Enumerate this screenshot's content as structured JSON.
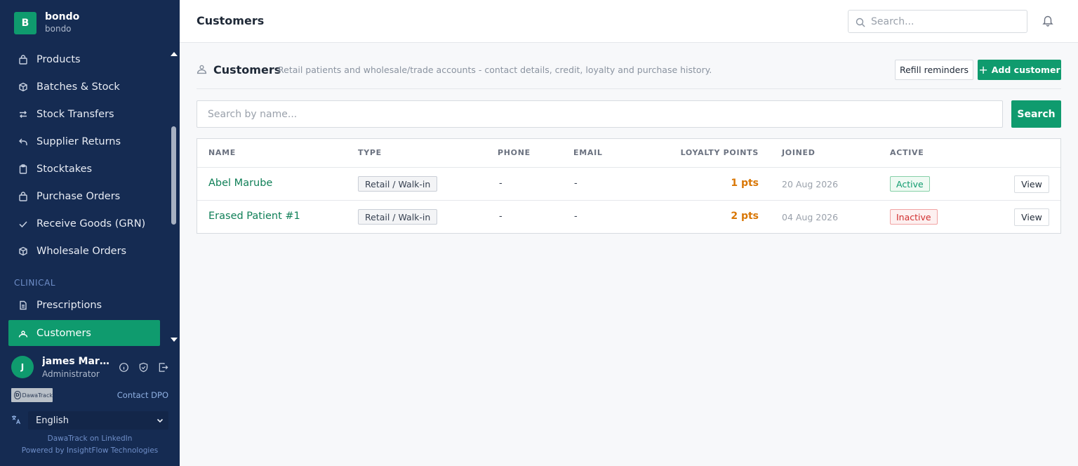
{
  "brand": {
    "initial": "B",
    "name": "bondo",
    "subtitle": "bondo"
  },
  "sidebar": {
    "items": [
      {
        "label": "Products",
        "icon": "bag-icon"
      },
      {
        "label": "Batches & Stock",
        "icon": "box-icon"
      },
      {
        "label": "Stock Transfers",
        "icon": "transfer-arrows-icon"
      },
      {
        "label": "Supplier Returns",
        "icon": "return-arrow-icon"
      },
      {
        "label": "Stocktakes",
        "icon": "clipboard-icon"
      },
      {
        "label": "Purchase Orders",
        "icon": "bag-icon"
      },
      {
        "label": "Receive Goods (GRN)",
        "icon": "check-icon"
      },
      {
        "label": "Wholesale Orders",
        "icon": "box-icon"
      }
    ],
    "section_clinical": "CLINICAL",
    "clinical_items": [
      {
        "label": "Prescriptions",
        "icon": "document-icon"
      },
      {
        "label": "Customers",
        "icon": "users-icon",
        "active": true
      }
    ]
  },
  "user": {
    "initial": "J",
    "name": "james Maru...",
    "role": "Administrator"
  },
  "dpo": {
    "logo_text": "DawaTrack",
    "contact_label": "Contact DPO"
  },
  "language": {
    "selected": "English"
  },
  "footer": {
    "linkedin": "DawaTrack on LinkedIn",
    "powered_by": "Powered by InsightFlow Technologies"
  },
  "topbar": {
    "title": "Customers",
    "search_placeholder": "Search..."
  },
  "content": {
    "title": "Customers",
    "description": "Retail patients and wholesale/trade accounts - contact details, credit, loyalty and purchase history.",
    "refill_label": "Refill reminders",
    "add_label": "Add customer",
    "search_placeholder": "Search by name...",
    "search_button": "Search"
  },
  "table": {
    "columns": [
      "NAME",
      "TYPE",
      "PHONE",
      "EMAIL",
      "LOYALTY POINTS",
      "JOINED",
      "ACTIVE"
    ],
    "rows": [
      {
        "name": "Abel Marube",
        "type": "Retail / Walk-in",
        "phone": "-",
        "email": "-",
        "points": "1 pts",
        "joined": "20 Aug 2026",
        "active": "Active",
        "action": "View"
      },
      {
        "name": "Erased Patient #1",
        "type": "Retail / Walk-in",
        "phone": "-",
        "email": "-",
        "points": "2 pts",
        "joined": "04 Aug 2026",
        "active": "Inactive",
        "action": "View"
      }
    ]
  },
  "colors": {
    "sidebar_bg": "#152b52",
    "accent": "#0f9b6e",
    "points": "#d97706",
    "inactive": "#d12f2f"
  }
}
